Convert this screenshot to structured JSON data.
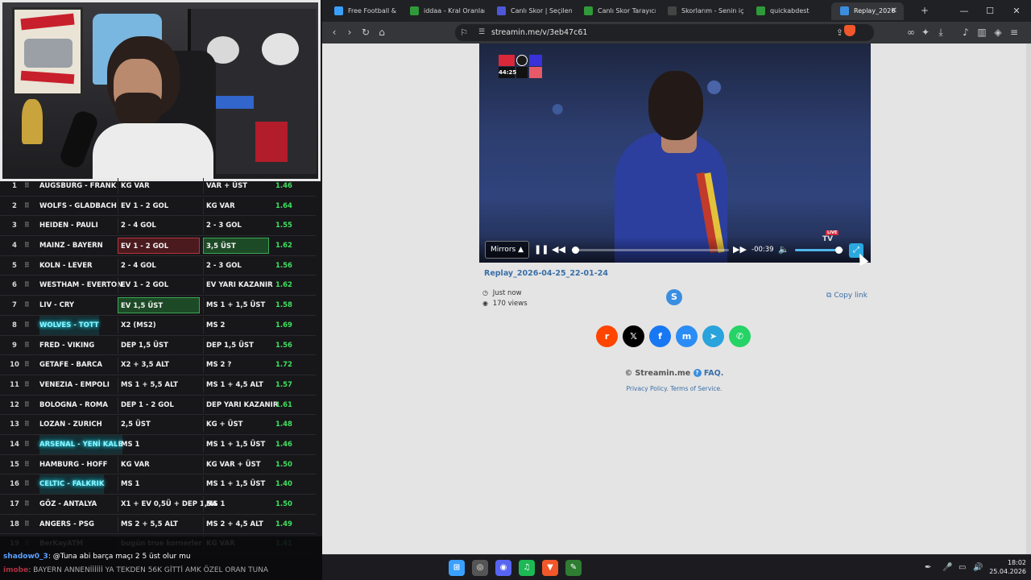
{
  "browser": {
    "tabs": [
      {
        "label": "Free Football & Play",
        "icon": "football-icon",
        "color": "#3aa0ff"
      },
      {
        "label": "iddaa - Kral Oranlar",
        "icon": "leaf-icon",
        "color": "#2f9a3a"
      },
      {
        "label": "Canlı Skor | Seçilen",
        "icon": "score-icon",
        "color": "#4d58d8"
      },
      {
        "label": "Canlı Skor Tarayıcısı",
        "icon": "leaf-icon",
        "color": "#2f9a3a"
      },
      {
        "label": "Skorlarım - Senin iç",
        "icon": "365-icon",
        "color": "#444444"
      },
      {
        "label": "quickabdest",
        "icon": "leaf-icon",
        "color": "#2f9a3a"
      },
      {
        "label": "Replay_2026",
        "icon": "streamin-icon",
        "color": "#3a8ee0"
      }
    ],
    "address": "streamin.me/v/3eb47c61",
    "extension_badge": "2"
  },
  "player": {
    "scorebug_time": "44:25",
    "mirrors_label": "Mirrors",
    "time_remaining": "-00:39",
    "progress_fraction": 0.02,
    "volume_fraction": 0.9,
    "live_label": "LIVE",
    "tv_label": "TV"
  },
  "video": {
    "title": "Replay_2026-04-25_22-01-24",
    "posted": "Just now",
    "views": "170 views",
    "copy_link": "Copy link"
  },
  "share": [
    {
      "name": "reddit",
      "glyph": "r",
      "color": "#ff4500"
    },
    {
      "name": "x",
      "glyph": "𝕏",
      "color": "#000000"
    },
    {
      "name": "facebook",
      "glyph": "f",
      "color": "#1877f2"
    },
    {
      "name": "messenger",
      "glyph": "m",
      "color": "#2b8cf5"
    },
    {
      "name": "telegram",
      "glyph": "➤",
      "color": "#2aa3dc"
    },
    {
      "name": "whatsapp",
      "glyph": "✆",
      "color": "#25d366"
    }
  ],
  "footer": {
    "copyright": "© Streamin.me",
    "faq": "FAQ.",
    "privacy": "Privacy Policy.",
    "terms": "Terms of Service."
  },
  "bets": [
    {
      "num": "1",
      "match": "AUGSBURG - FRANK",
      "bet1": "KG VAR",
      "bet2": "VAR + ÜST",
      "odds": "1.46",
      "hl": false,
      "b1": "",
      "b2": ""
    },
    {
      "num": "2",
      "match": "WOLFS - GLADBACH",
      "bet1": "EV 1 - 2 GOL",
      "bet2": "KG VAR",
      "odds": "1.64",
      "hl": false,
      "b1": "",
      "b2": ""
    },
    {
      "num": "3",
      "match": "HEIDEN - PAULI",
      "bet1": "2 - 4 GOL",
      "bet2": "2 - 3 GOL",
      "odds": "1.55",
      "hl": false,
      "b1": "",
      "b2": ""
    },
    {
      "num": "4",
      "match": "MAINZ - BAYERN",
      "bet1": "EV 1 - 2 GOL",
      "bet2": "3,5 ÜST",
      "odds": "1.62",
      "hl": false,
      "b1": "red",
      "b2": "green"
    },
    {
      "num": "5",
      "match": "KOLN - LEVER",
      "bet1": "2 - 4 GOL",
      "bet2": "2 - 3 GOL",
      "odds": "1.56",
      "hl": false,
      "b1": "",
      "b2": ""
    },
    {
      "num": "6",
      "match": "WESTHAM - EVERTON",
      "bet1": "EV 1 - 2 GOL",
      "bet2": "EV YARI KAZANIR",
      "odds": "1.62",
      "hl": false,
      "b1": "",
      "b2": ""
    },
    {
      "num": "7",
      "match": "LIV - CRY",
      "bet1": "EV 1,5 ÜST",
      "bet2": "MS 1 + 1,5 ÜST",
      "odds": "1.58",
      "hl": false,
      "b1": "green",
      "b2": ""
    },
    {
      "num": "8",
      "match": "WOLVES - TOTT",
      "bet1": "X2 (MS2)",
      "bet2": "MS 2",
      "odds": "1.69",
      "hl": true,
      "b1": "",
      "b2": ""
    },
    {
      "num": "9",
      "match": "FRED - VIKING",
      "bet1": "DEP 1,5 ÜST",
      "bet2": "DEP 1,5 ÜST",
      "odds": "1.56",
      "hl": false,
      "b1": "",
      "b2": ""
    },
    {
      "num": "10",
      "match": "GETAFE - BARCA",
      "bet1": "X2 + 3,5 ALT",
      "bet2": "MS 2 ?",
      "odds": "1.72",
      "hl": false,
      "b1": "",
      "b2": ""
    },
    {
      "num": "11",
      "match": "VENEZIA - EMPOLI",
      "bet1": "MS 1 + 5,5 ALT",
      "bet2": "MS 1 + 4,5 ALT",
      "odds": "1.57",
      "hl": false,
      "b1": "",
      "b2": ""
    },
    {
      "num": "12",
      "match": "BOLOGNA - ROMA",
      "bet1": "DEP 1 - 2 GOL",
      "bet2": "DEP YARI KAZANIR",
      "odds": "1.61",
      "hl": false,
      "b1": "",
      "b2": ""
    },
    {
      "num": "13",
      "match": "LOZAN - ZURICH",
      "bet1": "2,5 ÜST",
      "bet2": "KG + ÜST",
      "odds": "1.48",
      "hl": false,
      "b1": "",
      "b2": ""
    },
    {
      "num": "14",
      "match": "ARSENAL - YENİ KALE",
      "bet1": "MS 1",
      "bet2": "MS 1 + 1,5 ÜST",
      "odds": "1.46",
      "hl": true,
      "b1": "",
      "b2": ""
    },
    {
      "num": "15",
      "match": "HAMBURG - HOFF",
      "bet1": "KG VAR",
      "bet2": "KG VAR + ÜST",
      "odds": "1.50",
      "hl": false,
      "b1": "",
      "b2": ""
    },
    {
      "num": "16",
      "match": "CELTIC - FALKRIK",
      "bet1": "MS 1",
      "bet2": "MS 1 + 1,5 ÜST",
      "odds": "1.40",
      "hl": true,
      "b1": "",
      "b2": ""
    },
    {
      "num": "17",
      "match": "GÖZ - ANTALYA",
      "bet1": "X1 + EV 0,5Ü + DEP 1,5A",
      "bet2": "MS 1",
      "odds": "1.50",
      "hl": false,
      "b1": "",
      "b2": ""
    },
    {
      "num": "18",
      "match": "ANGERS - PSG",
      "bet1": "MS 2 + 5,5 ALT",
      "bet2": "MS 2 + 4,5 ALT",
      "odds": "1.49",
      "hl": false,
      "b1": "",
      "b2": ""
    },
    {
      "num": "19",
      "match": "BerKayATM",
      "bet1": "bugün true kornerler",
      "bet2": "KG VAR",
      "odds": "1.41",
      "hl": false,
      "b1": "",
      "b2": ""
    }
  ],
  "chat": [
    {
      "user": "shadow0_3",
      "user_color": "#5aa0ff",
      "text": ": @Tuna abi barça maçı 2 5 üst olur mu",
      "text_color": "#ffffff"
    },
    {
      "user": "imobe",
      "user_color": "#b03040",
      "text": ": BAYERN ANNENİİİİİİ YA TEKDEN 56K GİTTİ AMK ÖZEL ORAN TUNA",
      "text_color": "#aaaaaa"
    }
  ],
  "taskbar": {
    "apps": [
      {
        "name": "windows-start",
        "glyph": "⊞",
        "color": "#3aa0ff"
      },
      {
        "name": "chrome",
        "glyph": "◎",
        "color": "#555555"
      },
      {
        "name": "discord",
        "glyph": "◉",
        "color": "#5865f2"
      },
      {
        "name": "spotify",
        "glyph": "♫",
        "color": "#1db954"
      },
      {
        "name": "brave",
        "glyph": "▼",
        "color": "#f0572a"
      },
      {
        "name": "excel-like",
        "glyph": "✎",
        "color": "#2e7d32"
      }
    ],
    "time": "18:02",
    "date": "25.04.2026"
  }
}
